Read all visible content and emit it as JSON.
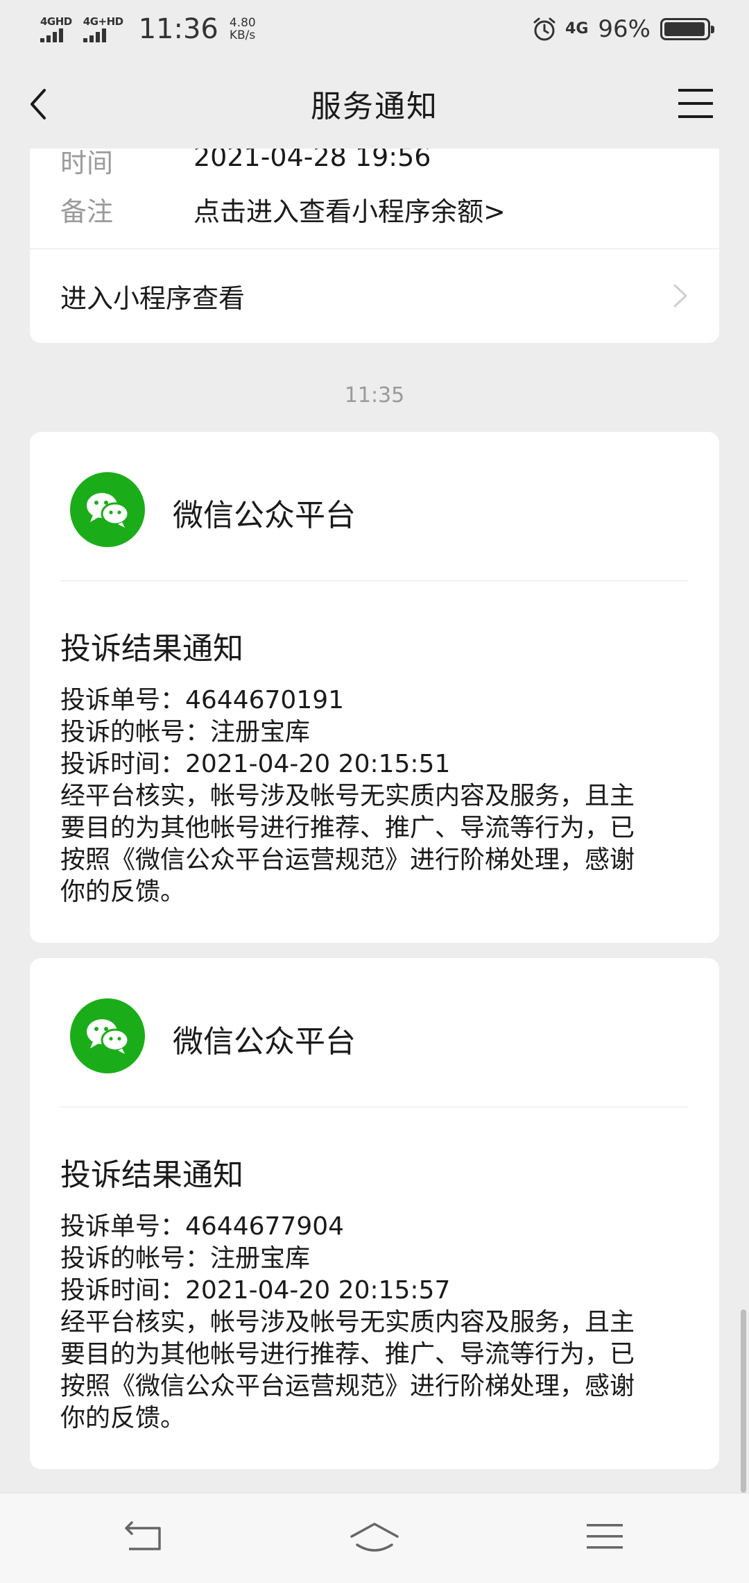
{
  "status_bar": {
    "signal1": "4GHD",
    "signal2": "4G+HD",
    "time": "11:36",
    "speed_value": "4.80",
    "speed_unit": "KB/s",
    "network": "4G",
    "battery_percent": "96%",
    "battery_level": 0.96
  },
  "nav": {
    "title": "服务通知"
  },
  "top_card": {
    "time_label": "时间",
    "time_value": "2021-04-28 19:56",
    "note_label": "备注",
    "note_value": "点击进入查看小程序余额>",
    "entry_label": "进入小程序查看"
  },
  "timestamp": "11:35",
  "notices": [
    {
      "source": "微信公众平台",
      "title": "投诉结果通知",
      "lines": [
        "投诉单号：4644670191",
        "投诉的帐号：注册宝库",
        "投诉时间：2021-04-20 20:15:51",
        "经平台核实，帐号涉及帐号无实质内容及服务，且主",
        "要目的为其他帐号进行推荐、推广、导流等行为，已",
        "按照《微信公众平台运营规范》进行阶梯处理，感谢",
        "你的反馈。"
      ]
    },
    {
      "source": "微信公众平台",
      "title": "投诉结果通知",
      "lines": [
        "投诉单号：4644677904",
        "投诉的帐号：注册宝库",
        "投诉时间：2021-04-20 20:15:57",
        "经平台核实，帐号涉及帐号无实质内容及服务，且主",
        "要目的为其他帐号进行推荐、推广、导流等行为，已",
        "按照《微信公众平台运营规范》进行阶梯处理，感谢",
        "你的反馈。"
      ]
    }
  ],
  "colors": {
    "brand_green": "#1aad19",
    "background": "#ededed"
  },
  "icons": [
    "back-icon",
    "menu-icon",
    "chevron-right-icon",
    "wechat-icon",
    "sys-back-icon",
    "sys-home-icon",
    "sys-menu-icon",
    "alarm-icon"
  ]
}
